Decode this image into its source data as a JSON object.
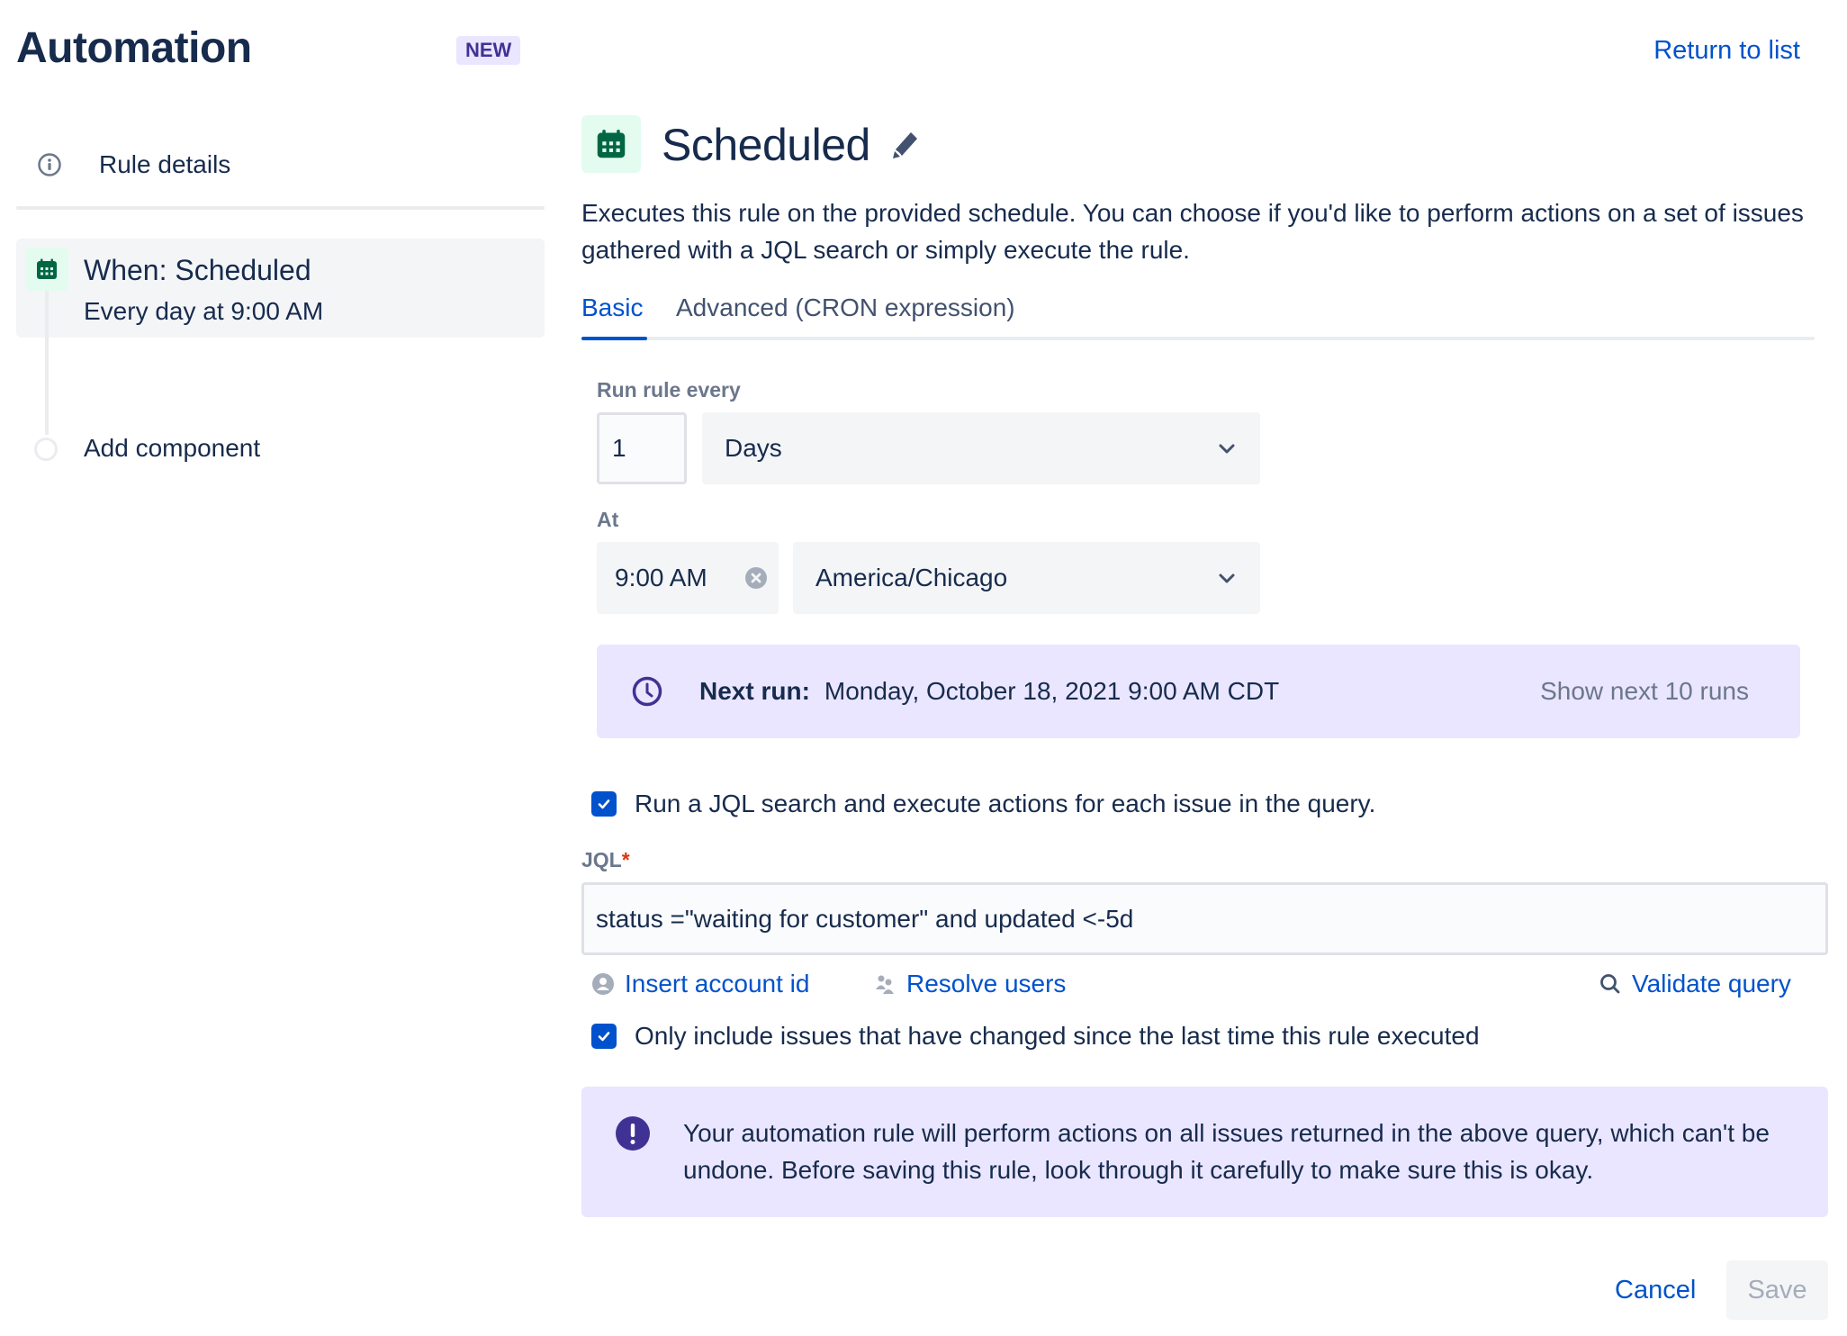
{
  "header": {
    "title": "Automation",
    "badge": "NEW",
    "return_link": "Return to list"
  },
  "sidebar": {
    "rule_details": "Rule details",
    "trigger": {
      "title": "When: Scheduled",
      "subtitle": "Every day at 9:00 AM",
      "icon": "calendar-icon"
    },
    "add_component": "Add component"
  },
  "main": {
    "title": "Scheduled",
    "description": "Executes this rule on the provided schedule. You can choose if you'd like to perform actions on a set of issues gathered with a JQL search or simply execute the rule.",
    "tabs": [
      {
        "label": "Basic",
        "active": true
      },
      {
        "label": "Advanced (CRON expression)",
        "active": false
      }
    ],
    "run_rule_every": {
      "label": "Run rule every",
      "value": "1",
      "unit": "Days"
    },
    "at": {
      "label": "At",
      "time": "9:00 AM",
      "timezone": "America/Chicago"
    },
    "next_run": {
      "label": "Next run:",
      "value": "Monday, October 18, 2021 9:00 AM CDT",
      "show_more": "Show next 10 runs"
    },
    "jql_checkbox": {
      "label": "Run a JQL search and execute actions for each issue in the query.",
      "checked": true
    },
    "jql": {
      "label": "JQL",
      "required_marker": "*",
      "value": "status =\"waiting for customer\" and updated <-5d"
    },
    "links": {
      "insert_account_id": "Insert account id",
      "resolve_users": "Resolve users",
      "validate_query": "Validate query"
    },
    "changed_checkbox": {
      "label": "Only include issues that have changed since the last time this rule executed",
      "checked": true
    },
    "warning": "Your automation rule will perform actions on all issues returned in the above query, which can't be undone. Before saving this rule, look through it carefully to make sure this is okay.",
    "buttons": {
      "cancel": "Cancel",
      "save": "Save"
    }
  },
  "colors": {
    "primary": "#0052cc",
    "text": "#172b4d",
    "subtle": "#6b778c",
    "info_bg": "#eae6ff",
    "discovery": "#403294",
    "success_bg": "#e3fcef",
    "success_icon": "#006644"
  }
}
